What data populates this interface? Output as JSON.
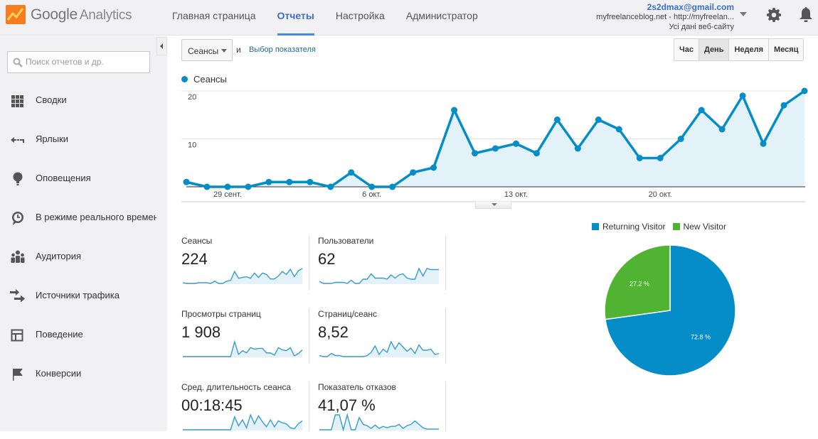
{
  "header": {
    "brand": "Google",
    "product": "Analytics",
    "nav": [
      {
        "label": "Главная страница",
        "active": false
      },
      {
        "label": "Отчеты",
        "active": true
      },
      {
        "label": "Настройка",
        "active": false
      },
      {
        "label": "Администратор",
        "active": false
      }
    ],
    "account": {
      "email": "2s2dmax@gmail.com",
      "property": "myfreelanceblog.net - http://myfreelan...",
      "view": "Усі дані веб-сайту"
    },
    "icons": [
      "settings-gear-icon",
      "notifications-bell-icon"
    ]
  },
  "sidebar": {
    "search_placeholder": "Поиск отчетов и др.",
    "items": [
      {
        "label": "Сводки",
        "icon": "dashboard-grid-icon"
      },
      {
        "label": "Ярлыки",
        "icon": "shortcut-arrow-icon"
      },
      {
        "label": "Оповещения",
        "icon": "bulb-icon"
      },
      {
        "label": "В режиме реального времени",
        "icon": "clock-icon"
      },
      {
        "label": "Аудитория",
        "icon": "people-icon"
      },
      {
        "label": "Источники трафика",
        "icon": "arrows-icon"
      },
      {
        "label": "Поведение",
        "icon": "layout-icon"
      },
      {
        "label": "Конверсии",
        "icon": "flag-icon"
      }
    ]
  },
  "toolbar": {
    "metric_selected": "Сеансы",
    "and_label": "и",
    "pick_metric_link": "Выбор показателя",
    "granularity": [
      {
        "label": "Час",
        "active": false
      },
      {
        "label": "День",
        "active": true
      },
      {
        "label": "Неделя",
        "active": false
      },
      {
        "label": "Месяц",
        "active": false
      }
    ]
  },
  "colors": {
    "series": "#058dc7",
    "returning": "#058dc7",
    "new": "#50b432",
    "accent": "#3b6fc6"
  },
  "chart_data": [
    {
      "type": "area",
      "title": "",
      "legend": [
        "Сеансы"
      ],
      "series": [
        {
          "name": "Сеансы",
          "values": [
            1,
            0,
            0,
            0,
            1,
            1,
            1,
            0,
            3,
            0,
            0,
            3,
            4,
            16,
            7,
            8,
            9,
            7,
            14,
            8,
            14,
            12,
            6,
            6,
            10,
            16,
            12,
            19,
            9,
            17,
            20
          ]
        }
      ],
      "y_ticks": [
        "10",
        "20"
      ],
      "ylim": [
        0,
        20
      ],
      "x_tick_labels": [
        {
          "index": 2,
          "label": "29 сент."
        },
        {
          "index": 9,
          "label": "6 окт."
        },
        {
          "index": 16,
          "label": "13 окт."
        },
        {
          "index": 23,
          "label": "20 окт."
        }
      ],
      "grid": true
    },
    {
      "type": "pie",
      "legend_position": "top",
      "slices": [
        {
          "label": "Returning Visitor",
          "value": 72.8,
          "display": "72.8 %"
        },
        {
          "label": "New Visitor",
          "value": 27.2,
          "display": "27.2 %"
        }
      ]
    }
  ],
  "scorecards": [
    {
      "title": "Сеансы",
      "value": "224",
      "spark": [
        1,
        0,
        0,
        0,
        1,
        1,
        1,
        0,
        3,
        0,
        0,
        3,
        4,
        16,
        7,
        8,
        9,
        7,
        14,
        8,
        14,
        12,
        6,
        6,
        10,
        16,
        12,
        19,
        9,
        17,
        20
      ]
    },
    {
      "title": "Пользователи",
      "value": "62",
      "spark": [
        2,
        0,
        0,
        0,
        1,
        1,
        1,
        0,
        3,
        0,
        0,
        4,
        4,
        9,
        5,
        5,
        5,
        4,
        8,
        5,
        8,
        9,
        5,
        4,
        4,
        14,
        7,
        14,
        13,
        13,
        13
      ]
    },
    {
      "title": "Просмотры страниц",
      "value": "1 908",
      "spark": [
        0,
        0,
        0,
        0,
        0,
        0,
        0,
        0,
        0,
        0,
        0,
        0,
        0,
        20,
        3,
        8,
        5,
        12,
        10,
        11,
        11,
        5,
        5,
        2,
        12,
        9,
        8,
        12,
        1,
        4,
        9
      ]
    },
    {
      "title": "Страниц/сеанс",
      "value": "8,52",
      "spark": [
        1,
        0,
        0,
        3,
        1,
        1,
        0,
        0,
        0,
        0,
        0,
        0,
        1,
        4,
        10,
        2,
        7,
        4,
        14,
        7,
        13,
        9,
        5,
        8,
        3,
        11,
        6,
        6,
        7,
        2,
        3
      ]
    },
    {
      "title": "Сред. длительность сеанса",
      "value": "00:18:45",
      "spark": [
        0,
        0,
        0,
        0,
        0,
        0,
        0,
        0,
        0,
        0,
        0,
        0,
        0,
        13,
        4,
        10,
        2,
        15,
        6,
        14,
        8,
        3,
        10,
        3,
        9,
        7,
        6,
        2,
        1,
        6,
        9
      ]
    },
    {
      "title": "Показатель отказов",
      "value": "41,07 %",
      "spark": [
        0,
        0,
        0,
        0,
        22,
        22,
        0,
        22,
        0,
        0,
        18,
        8,
        6,
        2,
        7,
        2,
        5,
        3,
        5,
        5,
        8,
        2,
        6,
        8,
        13,
        8,
        3,
        1,
        1,
        1,
        1
      ]
    }
  ]
}
